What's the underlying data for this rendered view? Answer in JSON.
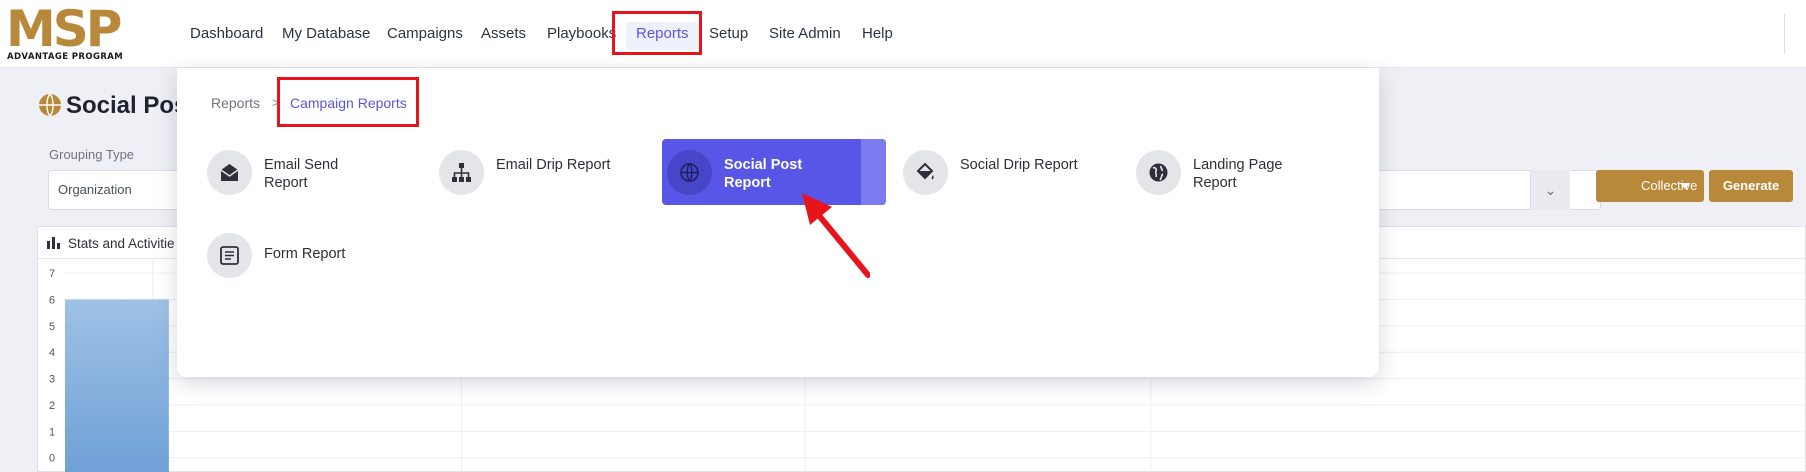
{
  "brand": {
    "logo_text": "MSP",
    "tagline": "ADVANTAGE PROGRAM",
    "accent_color": "#b8893b"
  },
  "nav": {
    "items": [
      {
        "label": "Dashboard"
      },
      {
        "label": "My Database"
      },
      {
        "label": "Campaigns"
      },
      {
        "label": "Assets"
      },
      {
        "label": "Playbooks"
      },
      {
        "label": "Reports",
        "active": true
      },
      {
        "label": "Setup"
      },
      {
        "label": "Site Admin"
      },
      {
        "label": "Help"
      }
    ],
    "active_color": "#5b57d6"
  },
  "page": {
    "title": "Social Post",
    "grouping_label": "Grouping Type",
    "grouping_value": "Organization",
    "collective_label": "Collective",
    "generate_label": "Generate",
    "stats_title": "Stats and Activitie",
    "y_ticks": [
      "7",
      "6",
      "5",
      "4",
      "3",
      "2",
      "1",
      "0"
    ]
  },
  "dropdown": {
    "breadcrumb": [
      "Reports",
      "Campaign Reports"
    ],
    "reports": [
      {
        "label": "Email Send Report",
        "icon": "envelope-open-icon"
      },
      {
        "label": "Email Drip Report",
        "icon": "sitemap-icon"
      },
      {
        "label": "Social Post Report",
        "icon": "globe-icon",
        "active": true
      },
      {
        "label": "Social Drip Report",
        "icon": "paint-bucket-icon"
      },
      {
        "label": "Landing Page Report",
        "icon": "globe-americas-icon"
      },
      {
        "label": "Form Report",
        "icon": "form-icon"
      }
    ],
    "active_color": "#5756e6"
  },
  "chart_data": {
    "type": "bar",
    "title": "",
    "categories": [
      ""
    ],
    "values": [
      6
    ],
    "ylim": [
      0,
      7
    ],
    "grid": true
  },
  "annotations": {
    "highlight_color": "#e8141b"
  }
}
